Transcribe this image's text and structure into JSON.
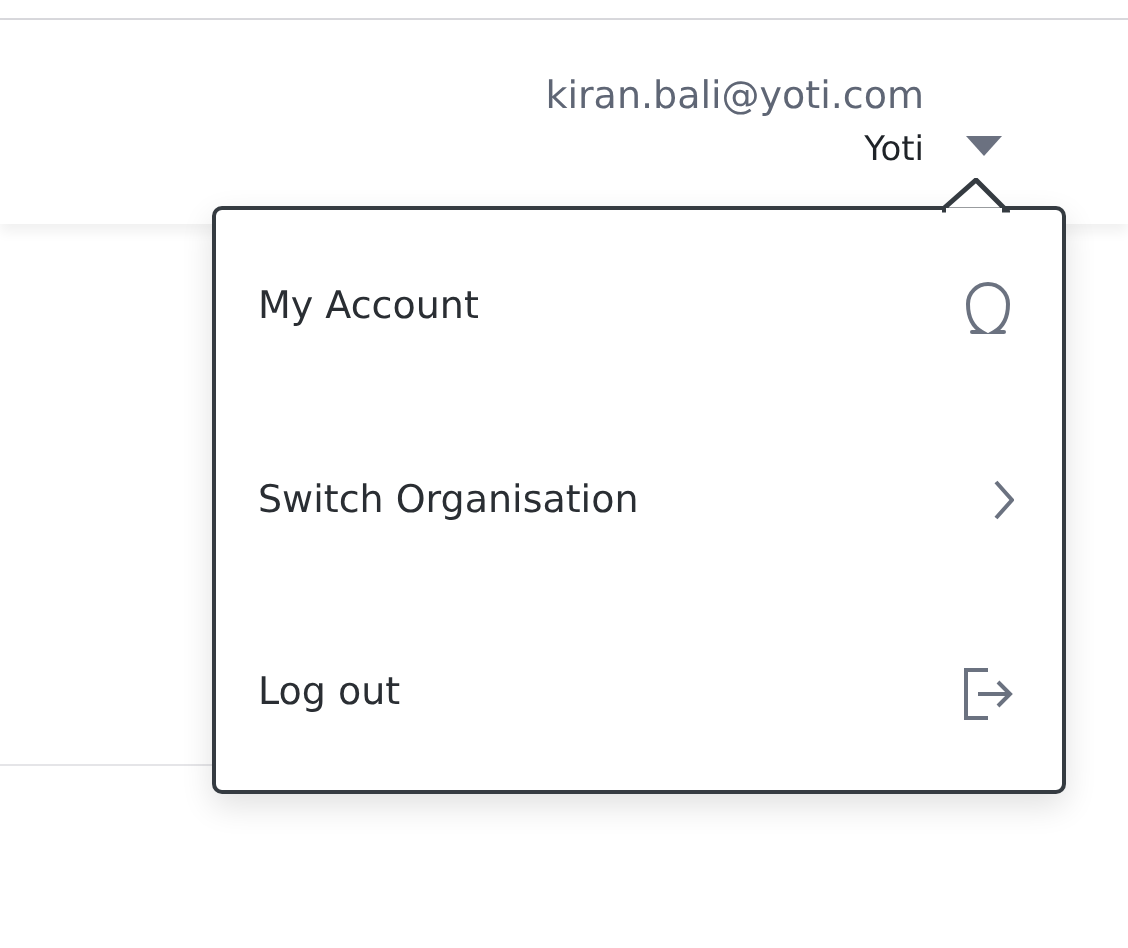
{
  "user": {
    "email": "kiran.bali@yoti.com",
    "organisation": "Yoti"
  },
  "menu": {
    "expanded": true,
    "items": [
      {
        "label": "My Account",
        "kind": "account"
      },
      {
        "label": "Switch Organisation",
        "kind": "submenu"
      },
      {
        "label": "Log out",
        "kind": "logout"
      }
    ]
  }
}
